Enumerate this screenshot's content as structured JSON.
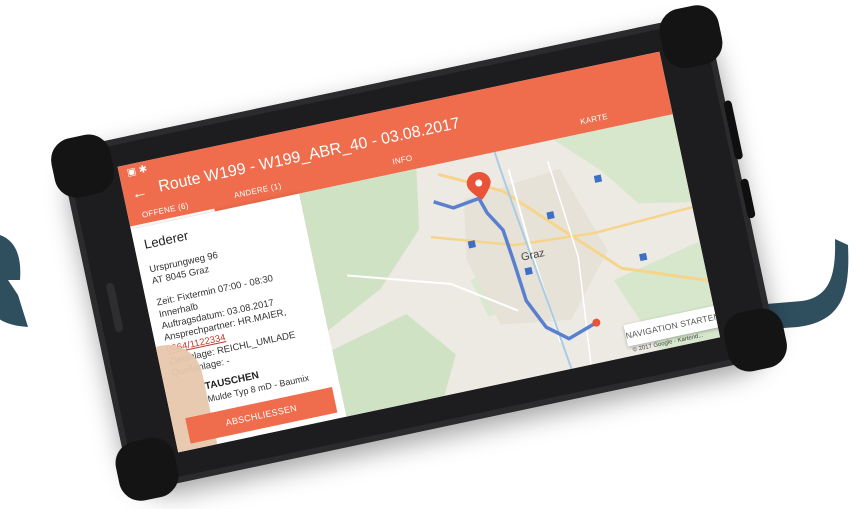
{
  "app": {
    "title": "Route W199 - W199_ABR_40 - 03.08.2017",
    "tabs": [
      {
        "label": "OFFENE (6)",
        "active": true
      },
      {
        "label": "ANDERE (1)",
        "active": false
      },
      {
        "label": "INFO",
        "active": false
      },
      {
        "label": "KARTE",
        "active": false
      }
    ]
  },
  "order": {
    "customer": "Lederer",
    "street": "Ursprungweg 96",
    "city": "AT 8045 Graz",
    "time": "Zeit: Fixtermin 07:00 - 08:30",
    "within": "Innerhalb",
    "order_date": "Auftragsdatum: 03.08.2017",
    "contact": "Ansprechpartner: HR.MAIER,",
    "phone": "0664/1122334",
    "target_site": "Zielanlage: REICHL_UMLADE",
    "source_site": "Quellanlage: -",
    "task_title": "TAUSCHEN",
    "task_sub": "Mulde Typ 8 mD - Baumix",
    "finish_label": "ABSCHLIESSEN"
  },
  "map": {
    "city_label": "Graz",
    "nav_label": "NAVIGATION STARTEN",
    "copyright": "© 2017 Google - Kartend..."
  },
  "colors": {
    "accent": "#ef6c4d",
    "route": "#5b7fd0",
    "arrow": "#2f4f5f"
  }
}
